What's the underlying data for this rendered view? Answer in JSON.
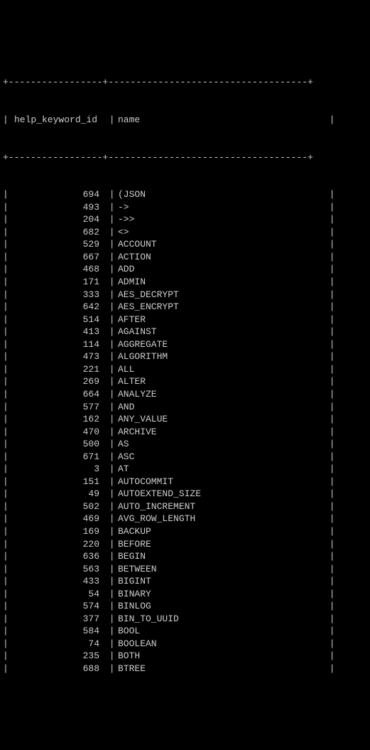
{
  "columns": {
    "id_header": "help_keyword_id",
    "name_header": "name"
  },
  "border": {
    "top": "+-----------------+------------------------------------+",
    "header": "+-----------------+------------------------------------+"
  },
  "rows": [
    {
      "id": "694",
      "name": "(JSON"
    },
    {
      "id": "493",
      "name": "->"
    },
    {
      "id": "204",
      "name": "->>"
    },
    {
      "id": "682",
      "name": "<>"
    },
    {
      "id": "529",
      "name": "ACCOUNT"
    },
    {
      "id": "667",
      "name": "ACTION"
    },
    {
      "id": "468",
      "name": "ADD"
    },
    {
      "id": "171",
      "name": "ADMIN"
    },
    {
      "id": "333",
      "name": "AES_DECRYPT"
    },
    {
      "id": "642",
      "name": "AES_ENCRYPT"
    },
    {
      "id": "514",
      "name": "AFTER"
    },
    {
      "id": "413",
      "name": "AGAINST"
    },
    {
      "id": "114",
      "name": "AGGREGATE"
    },
    {
      "id": "473",
      "name": "ALGORITHM"
    },
    {
      "id": "221",
      "name": "ALL"
    },
    {
      "id": "269",
      "name": "ALTER"
    },
    {
      "id": "664",
      "name": "ANALYZE"
    },
    {
      "id": "577",
      "name": "AND"
    },
    {
      "id": "162",
      "name": "ANY_VALUE"
    },
    {
      "id": "470",
      "name": "ARCHIVE"
    },
    {
      "id": "500",
      "name": "AS"
    },
    {
      "id": "671",
      "name": "ASC"
    },
    {
      "id": "3",
      "name": "AT"
    },
    {
      "id": "151",
      "name": "AUTOCOMMIT"
    },
    {
      "id": "49",
      "name": "AUTOEXTEND_SIZE"
    },
    {
      "id": "502",
      "name": "AUTO_INCREMENT"
    },
    {
      "id": "469",
      "name": "AVG_ROW_LENGTH"
    },
    {
      "id": "169",
      "name": "BACKUP"
    },
    {
      "id": "220",
      "name": "BEFORE"
    },
    {
      "id": "636",
      "name": "BEGIN"
    },
    {
      "id": "563",
      "name": "BETWEEN"
    },
    {
      "id": "433",
      "name": "BIGINT"
    },
    {
      "id": "54",
      "name": "BINARY"
    },
    {
      "id": "574",
      "name": "BINLOG"
    },
    {
      "id": "377",
      "name": "BIN_TO_UUID"
    },
    {
      "id": "584",
      "name": "BOOL"
    },
    {
      "id": "74",
      "name": "BOOLEAN"
    },
    {
      "id": "235",
      "name": "BOTH"
    },
    {
      "id": "688",
      "name": "BTREE"
    }
  ]
}
